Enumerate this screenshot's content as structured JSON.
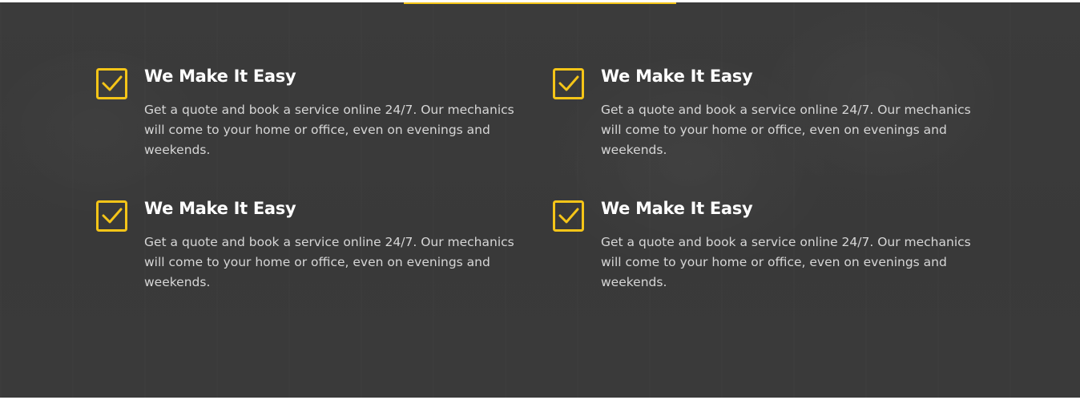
{
  "colors": {
    "accent": "#f5c518",
    "background": "#3a3a3a",
    "title": "#ffffff",
    "text": "#d6d6d6"
  },
  "features": [
    {
      "icon": "checkbox-checked-icon",
      "title": "We Make It Easy",
      "text": "Get a quote and book a service online 24/7. Our mechanics will come to your home or office, even on evenings and weekends."
    },
    {
      "icon": "checkbox-checked-icon",
      "title": "We Make It Easy",
      "text": "Get a quote and book a service online 24/7. Our mechanics will come to your home or office, even on evenings and weekends."
    },
    {
      "icon": "checkbox-checked-icon",
      "title": "We Make It Easy",
      "text": "Get a quote and book a service online 24/7. Our mechanics will come to your home or office, even on evenings and weekends."
    },
    {
      "icon": "checkbox-checked-icon",
      "title": "We Make It Easy",
      "text": "Get a quote and book a service online 24/7. Our mechanics will come to your home or office, even on evenings and weekends."
    }
  ]
}
